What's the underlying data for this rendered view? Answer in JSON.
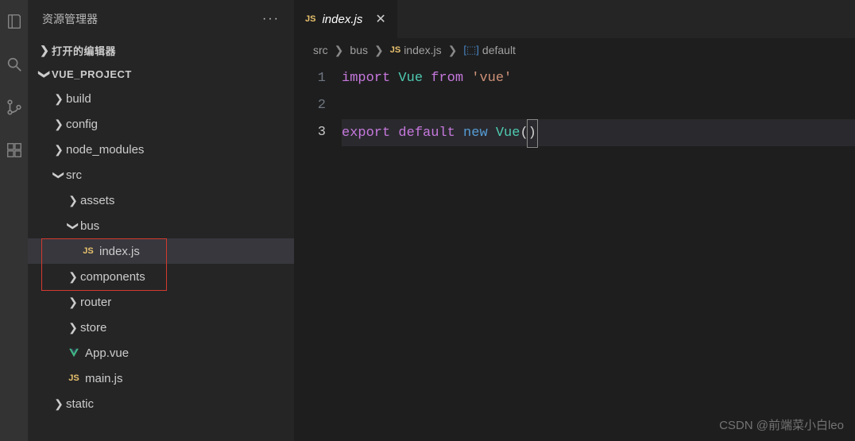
{
  "sidebar": {
    "title": "资源管理器",
    "sections": {
      "open_editors": "打开的编辑器",
      "project": "VUE_PROJECT"
    },
    "tree": {
      "build": "build",
      "config": "config",
      "node_modules": "node_modules",
      "src": "src",
      "assets": "assets",
      "bus": "bus",
      "index_js": "index.js",
      "components": "components",
      "router": "router",
      "store": "store",
      "app_vue": "App.vue",
      "main_js": "main.js",
      "static": "static"
    }
  },
  "tab": {
    "icon": "JS",
    "label": "index.js"
  },
  "breadcrumbs": {
    "src": "src",
    "bus": "bus",
    "file_icon": "JS",
    "file": "index.js",
    "symbol": "default"
  },
  "code": {
    "lines": [
      "1",
      "2",
      "3"
    ],
    "line1": {
      "import": "import",
      "vue": "Vue",
      "from": "from",
      "str": "'vue'"
    },
    "line3": {
      "export": "export",
      "default": "default",
      "new": "new",
      "vue": "Vue",
      "open": "(",
      "close": ")"
    }
  },
  "watermark": "CSDN @前端菜小白leo"
}
